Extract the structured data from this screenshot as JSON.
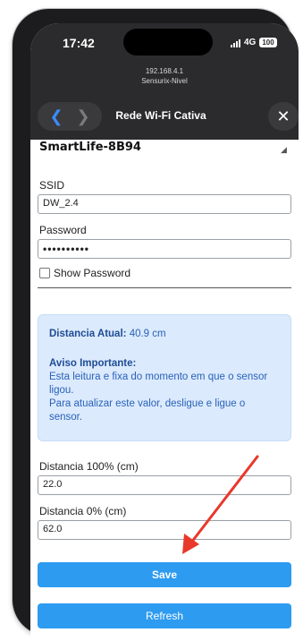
{
  "status": {
    "time": "17:42",
    "network": "4G",
    "battery": "100"
  },
  "browser": {
    "address_line1": "192.168.4.1",
    "address_line2": "Sensurix-Nivel",
    "title": "Rede Wi-Fi Cativa",
    "back_icon": "chevron-left-icon",
    "forward_icon": "chevron-right-icon",
    "close_icon": "close-icon"
  },
  "form": {
    "network_selected": "SmartLife-8B94",
    "ssid_label": "SSID",
    "ssid_value": "DW_2.4",
    "password_label": "Password",
    "password_value": "••••••••••",
    "show_password_label": "Show Password",
    "show_password_checked": false
  },
  "info_box": {
    "distance_label": "Distancia Atual:",
    "distance_value": "40.9 cm",
    "warning_title": "Aviso Importante:",
    "warning_text_1": "Esta leitura e fixa do momento em que o sensor ligou.",
    "warning_text_2": "Para atualizar este valor, desligue e ligue o sensor."
  },
  "calibration": {
    "full_label": "Distancia 100% (cm)",
    "full_value": "22.0",
    "empty_label": "Distancia 0% (cm)",
    "empty_value": "62.0"
  },
  "buttons": {
    "save": "Save",
    "refresh": "Refresh"
  },
  "colors": {
    "accent": "#2d9bf0",
    "info_bg": "#dceafd",
    "annotation_arrow": "#e8382b"
  }
}
